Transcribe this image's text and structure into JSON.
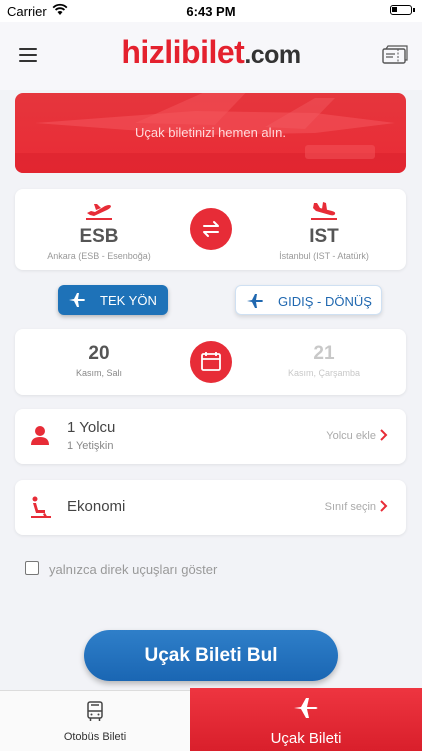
{
  "status_bar": {
    "carrier": "Carrier",
    "time": "6:43 PM"
  },
  "header": {
    "logo_brand": "hizlibilet",
    "logo_tld": ".com"
  },
  "banner": {
    "text": "Uçak biletinizi hemen alın."
  },
  "route": {
    "from": {
      "code": "ESB",
      "name": "Ankara (ESB - Esenboğa)"
    },
    "to": {
      "code": "IST",
      "name": "İstanbul (IST - Atatürk)"
    }
  },
  "trip_type": {
    "one_way": "TEK YÖN",
    "round_trip": "GIDIŞ - DÖNÜŞ",
    "selected": "one_way"
  },
  "dates": {
    "departure": {
      "day": "20",
      "label": "Kasım, Salı"
    },
    "return": {
      "day": "21",
      "label": "Kasım, Çarşamba"
    }
  },
  "passengers": {
    "title": "1 Yolcu",
    "subtitle": "1 Yetişkin",
    "action": "Yolcu ekle"
  },
  "cabin": {
    "title": "Ekonomi",
    "action": "Sınıf seçin"
  },
  "direct_only": {
    "label": "yalnızca direk uçuşları göster",
    "checked": false
  },
  "search": {
    "label": "Uçak Bileti Bul"
  },
  "tabs": {
    "bus": "Otobüs Bileti",
    "flight": "Uçak Bileti",
    "active": "flight"
  },
  "colors": {
    "brand_red": "#e72c37",
    "primary_blue": "#1e72b8"
  }
}
